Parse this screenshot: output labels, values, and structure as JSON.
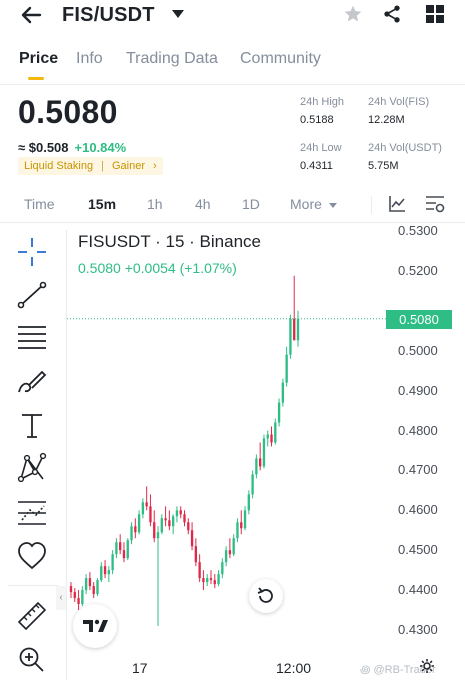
{
  "header": {
    "title": "FIS/USDT"
  },
  "tabs": [
    {
      "label": "Price",
      "active": true
    },
    {
      "label": "Info",
      "active": false
    },
    {
      "label": "Trading Data",
      "active": false
    },
    {
      "label": "Community",
      "active": false
    }
  ],
  "ticker": {
    "last_price": "0.5080",
    "usd_price": "≈ $0.508",
    "change_pct": "+10.84%",
    "tags": [
      "Liquid Staking",
      "Gainer"
    ],
    "tag_more": "›",
    "high_label": "24h High",
    "high_value": "0.5188",
    "low_label": "24h Low",
    "low_value": "0.4311",
    "vol_fis_label": "24h Vol(FIS)",
    "vol_fis_value": "12.28M",
    "vol_usdt_label": "24h Vol(USDT)",
    "vol_usdt_value": "5.75M"
  },
  "intervals": [
    {
      "label": "Time",
      "active": false
    },
    {
      "label": "15m",
      "active": true
    },
    {
      "label": "1h",
      "active": false
    },
    {
      "label": "4h",
      "active": false
    },
    {
      "label": "1D",
      "active": false
    },
    {
      "label": "More",
      "active": false
    }
  ],
  "colors": {
    "up": "#2ebd85",
    "down": "#e0294a",
    "accent": "#f0b90b"
  },
  "chart_data": {
    "type": "candlestick",
    "title": "FISUSDT · 15 · Binance",
    "legend_values": "0.5080  +0.0054 (+1.07%)",
    "last_price_label": "0.5080",
    "y_ticks": [
      "0.5300",
      "0.5200",
      "0.5000",
      "0.4900",
      "0.4800",
      "0.4700",
      "0.4600",
      "0.4500",
      "0.4400",
      "0.4300"
    ],
    "x_ticks": [
      "17",
      "12:00"
    ],
    "ylim": [
      0.4265,
      0.5325
    ],
    "candles": [
      [
        0.441,
        0.442,
        0.438,
        0.4395
      ],
      [
        0.4395,
        0.4405,
        0.437,
        0.438
      ],
      [
        0.438,
        0.44,
        0.435,
        0.4365
      ],
      [
        0.4365,
        0.441,
        0.436,
        0.44
      ],
      [
        0.44,
        0.444,
        0.439,
        0.443
      ],
      [
        0.443,
        0.4445,
        0.44,
        0.441
      ],
      [
        0.441,
        0.442,
        0.438,
        0.439
      ],
      [
        0.439,
        0.443,
        0.4385,
        0.4425
      ],
      [
        0.4425,
        0.447,
        0.442,
        0.446
      ],
      [
        0.446,
        0.4475,
        0.443,
        0.444
      ],
      [
        0.444,
        0.446,
        0.442,
        0.445
      ],
      [
        0.445,
        0.45,
        0.444,
        0.449
      ],
      [
        0.449,
        0.453,
        0.448,
        0.452
      ],
      [
        0.452,
        0.454,
        0.449,
        0.45
      ],
      [
        0.45,
        0.452,
        0.447,
        0.448
      ],
      [
        0.448,
        0.453,
        0.4475,
        0.4525
      ],
      [
        0.4525,
        0.457,
        0.4515,
        0.456
      ],
      [
        0.456,
        0.458,
        0.453,
        0.4545
      ],
      [
        0.4545,
        0.46,
        0.454,
        0.459
      ],
      [
        0.459,
        0.463,
        0.458,
        0.462
      ],
      [
        0.462,
        0.466,
        0.46,
        0.461
      ],
      [
        0.461,
        0.464,
        0.456,
        0.457
      ],
      [
        0.457,
        0.46,
        0.452,
        0.453
      ],
      [
        0.453,
        0.456,
        0.431,
        0.4545
      ],
      [
        0.4545,
        0.459,
        0.454,
        0.458
      ],
      [
        0.458,
        0.461,
        0.456,
        0.4575
      ],
      [
        0.4575,
        0.46,
        0.455,
        0.456
      ],
      [
        0.456,
        0.459,
        0.454,
        0.4585
      ],
      [
        0.4585,
        0.461,
        0.457,
        0.46
      ],
      [
        0.46,
        0.461,
        0.458,
        0.459
      ],
      [
        0.459,
        0.46,
        0.456,
        0.457
      ],
      [
        0.457,
        0.458,
        0.454,
        0.455
      ],
      [
        0.455,
        0.457,
        0.45,
        0.451
      ],
      [
        0.451,
        0.453,
        0.446,
        0.447
      ],
      [
        0.447,
        0.449,
        0.442,
        0.443
      ],
      [
        0.443,
        0.445,
        0.44,
        0.442
      ],
      [
        0.442,
        0.444,
        0.441,
        0.443
      ],
      [
        0.443,
        0.445,
        0.4415,
        0.4425
      ],
      [
        0.4425,
        0.444,
        0.4405,
        0.4415
      ],
      [
        0.4415,
        0.445,
        0.441,
        0.444
      ],
      [
        0.444,
        0.448,
        0.443,
        0.447
      ],
      [
        0.447,
        0.451,
        0.446,
        0.45
      ],
      [
        0.45,
        0.453,
        0.448,
        0.449
      ],
      [
        0.449,
        0.454,
        0.4485,
        0.453
      ],
      [
        0.453,
        0.458,
        0.452,
        0.457
      ],
      [
        0.457,
        0.46,
        0.454,
        0.4555
      ],
      [
        0.4555,
        0.461,
        0.455,
        0.46
      ],
      [
        0.46,
        0.465,
        0.459,
        0.464
      ],
      [
        0.464,
        0.47,
        0.463,
        0.469
      ],
      [
        0.469,
        0.474,
        0.468,
        0.473
      ],
      [
        0.473,
        0.477,
        0.47,
        0.471
      ],
      [
        0.471,
        0.479,
        0.4705,
        0.478
      ],
      [
        0.478,
        0.48,
        0.476,
        0.479
      ],
      [
        0.479,
        0.481,
        0.476,
        0.477
      ],
      [
        0.477,
        0.483,
        0.4765,
        0.482
      ],
      [
        0.482,
        0.488,
        0.481,
        0.487
      ],
      [
        0.487,
        0.493,
        0.486,
        0.492
      ],
      [
        0.492,
        0.501,
        0.491,
        0.499
      ],
      [
        0.499,
        0.509,
        0.498,
        0.508
      ],
      [
        0.508,
        0.5188,
        0.504,
        0.5026
      ],
      [
        0.5026,
        0.51,
        0.501,
        0.508
      ]
    ]
  }
}
